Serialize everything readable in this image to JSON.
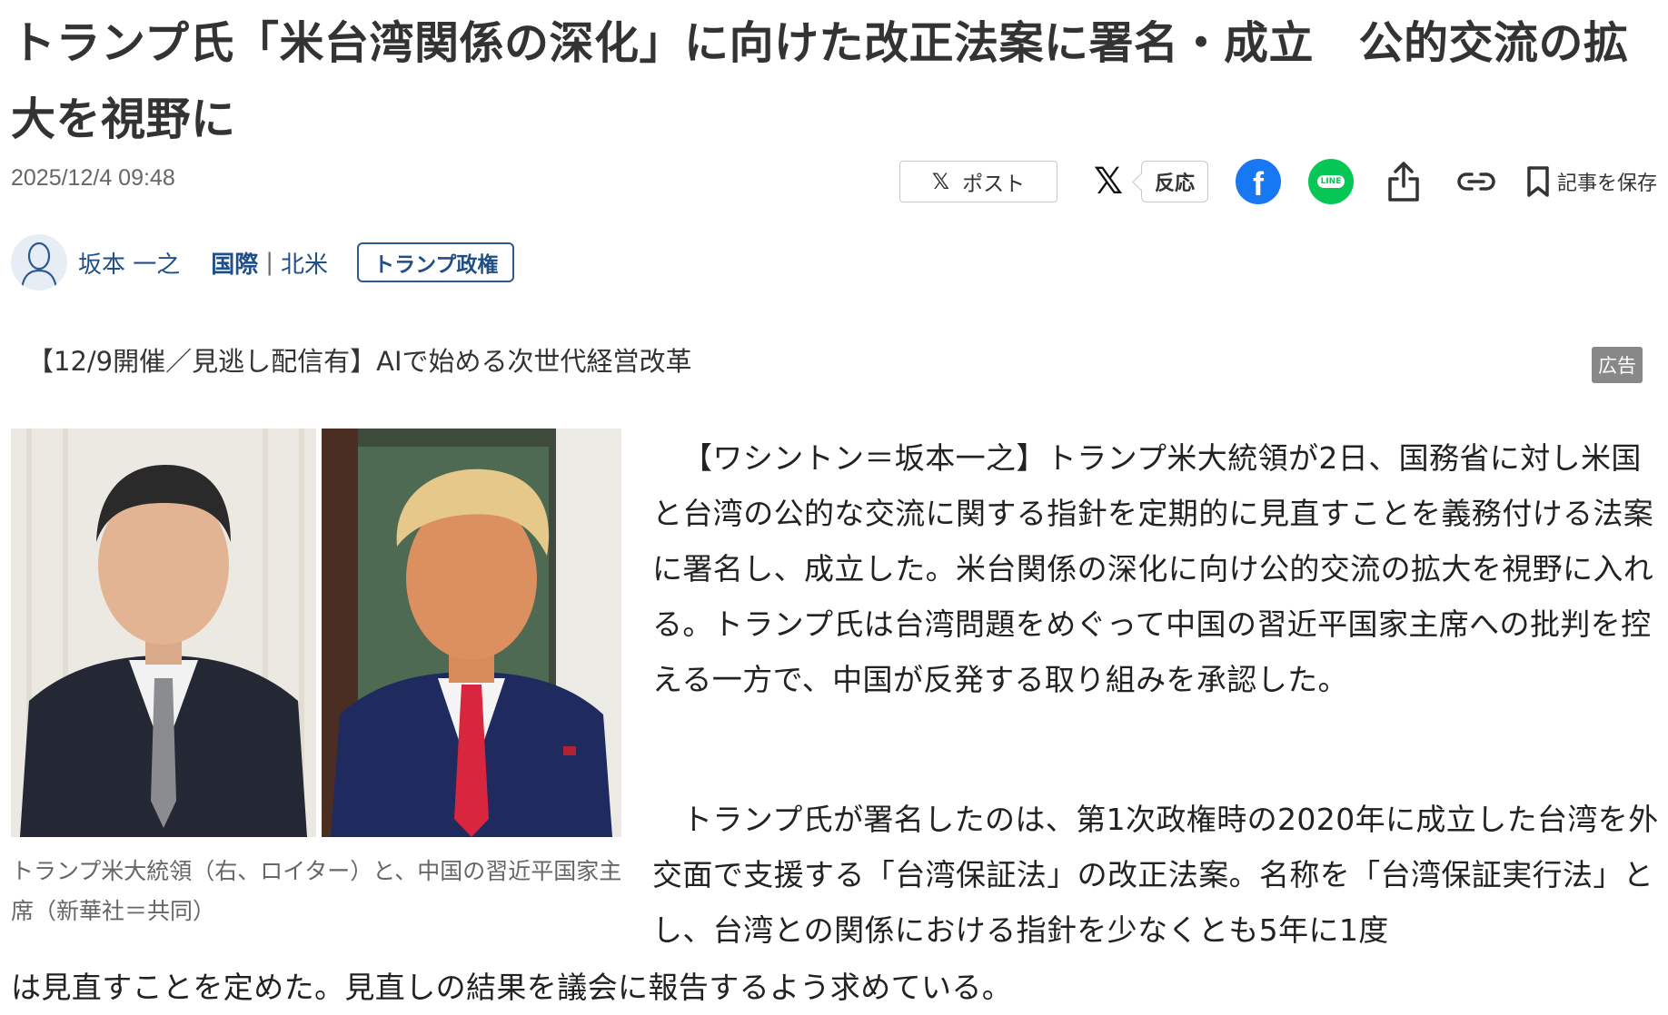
{
  "article": {
    "headline": "トランプ氏「米台湾関係の深化」に向けた改正法案に署名・成立　公的交流の拡大を視野に",
    "date": "2025/12/4 09:48"
  },
  "share": {
    "post_label": "ポスト",
    "reaction_label": "反応",
    "save_label": "記事を保存",
    "icons": [
      "x-icon",
      "facebook-icon",
      "line-icon",
      "share-icon",
      "link-icon",
      "bookmark-icon"
    ],
    "facebook_color": "#1877f2",
    "line_color": "#06c755",
    "line_text": "LINE"
  },
  "byline": {
    "author": "坂本 一之",
    "category": "国際",
    "subcategory": "北米",
    "topic_tag": "トランプ政権"
  },
  "ad": {
    "text": "【12/9開催／見逃し配信有】AIで始める次世代経営改革",
    "badge": "広告"
  },
  "photo": {
    "caption": "トランプ米大統領（右、ロイター）と、中国の習近平国家主席（新華社＝共同）"
  },
  "body": {
    "paragraph1": "【ワシントン＝坂本一之】トランプ米大統領が2日、国務省に対し米国と台湾の公的な交流に関する指針を定期的に見直すことを義務付ける法案に署名し、成立した。米台関係の深化に向け公的交流の拡大を視野に入れる。トランプ氏は台湾問題をめぐって中国の習近平国家主席への批判を控える一方で、中国が反発する取り組みを承認した。",
    "paragraph2": "トランプ氏が署名したのは、第1次政権時の2020年に成立した台湾を外交面で支援する「台湾保証法」の改正法案。名称を「台湾保証実行法」とし、台湾との関係における指針を少なくとも5年に1度",
    "paragraph2_end": "は見直すことを定めた。見直しの結果を議会に報告するよう求めている。"
  },
  "colors": {
    "link_blue": "#1f4f86",
    "ad_badge": "#888888"
  }
}
